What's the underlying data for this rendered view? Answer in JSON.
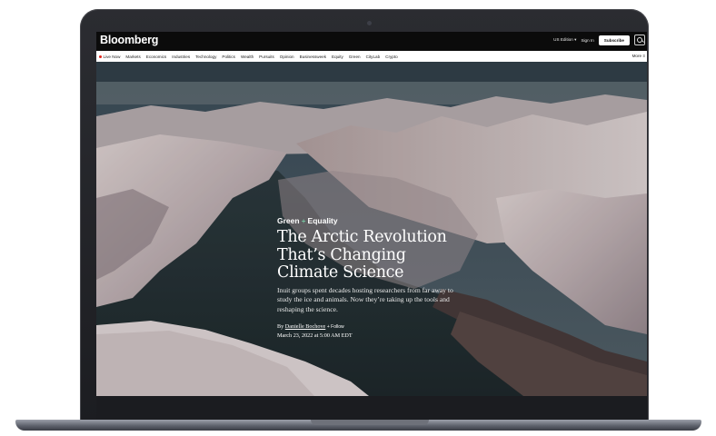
{
  "header": {
    "logo": "Bloomberg",
    "edition": "US Edition",
    "sign_in": "Sign In",
    "subscribe": "Subscribe",
    "search_icon": "search-icon"
  },
  "nav": {
    "items": [
      "Live Now",
      "Markets",
      "Economics",
      "Industries",
      "Technology",
      "Politics",
      "Wealth",
      "Pursuits",
      "Opinion",
      "Businessweek",
      "Equity",
      "Green",
      "CityLab",
      "Crypto"
    ],
    "more": "More"
  },
  "article": {
    "kicker_left": "Green",
    "kicker_separator": "+",
    "kicker_right": "Equality",
    "title_line1": "The Arctic Revolution",
    "title_line2": "That’s Changing",
    "title_line3": "Climate Science",
    "dek": "Inuit groups spent decades hosting researchers from far away to study the ice and animals. Now they’re taking up the tools and reshaping the science.",
    "byline_prefix": "By",
    "author": "Danielle Bochove",
    "follow": "+ Follow",
    "date": "March 23, 2022 at 5:00 AM EDT"
  },
  "colors": {
    "header_bg": "#0b0b0b",
    "live_dot": "#e0251b",
    "kicker_plus": "#7fe3b3"
  }
}
